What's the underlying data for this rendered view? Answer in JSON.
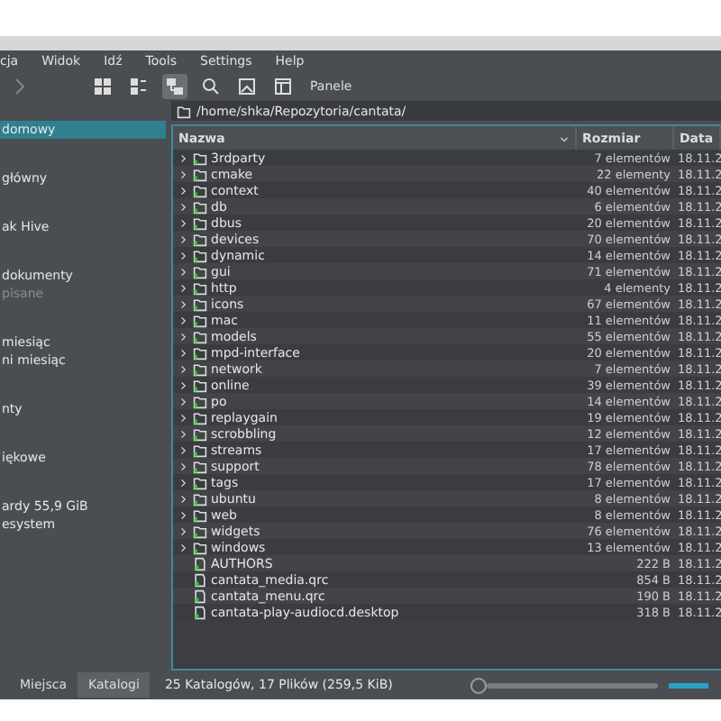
{
  "menu": [
    "cja",
    "Widok",
    "Idź",
    "Tools",
    "Settings",
    "Help"
  ],
  "toolbar": {
    "views": [
      {
        "selected": false
      },
      {
        "selected": false
      },
      {
        "selected": true
      }
    ],
    "panels_label": "Panele"
  },
  "sidebar": {
    "sections": [
      {
        "items": [
          {
            "label": "domowy",
            "selected": true,
            "disabled": false
          }
        ]
      },
      {
        "items": [
          {
            "label": "główny",
            "selected": false,
            "disabled": false
          }
        ]
      },
      {
        "items": [
          {
            "label": "ak Hive",
            "selected": false,
            "disabled": false
          }
        ]
      },
      {
        "items": [
          {
            "label": "dokumenty",
            "selected": false,
            "disabled": false
          },
          {
            "label": "pisane",
            "selected": false,
            "disabled": true
          }
        ]
      },
      {
        "items": [
          {
            "label": "miesiąc",
            "selected": false,
            "disabled": false
          },
          {
            "label": "ni miesiąc",
            "selected": false,
            "disabled": false
          }
        ]
      },
      {
        "items": [
          {
            "label": "nty",
            "selected": false,
            "disabled": false
          }
        ]
      },
      {
        "items": [
          {
            "label": "iękowe",
            "selected": false,
            "disabled": false
          }
        ]
      },
      {
        "items": [
          {
            "label": "ardy 55,9 GiB",
            "selected": false,
            "disabled": false
          },
          {
            "label": "esystem",
            "selected": false,
            "disabled": false
          }
        ]
      }
    ]
  },
  "path": "/home/shka/Repozytoria/cantata/",
  "columns": [
    "Nazwa",
    "Rozmiar",
    "Data"
  ],
  "rows": [
    {
      "kind": "folder",
      "name": "3rdparty",
      "size": "7 elementów",
      "date": "18.11.2"
    },
    {
      "kind": "folder",
      "name": "cmake",
      "size": "22 elementy",
      "date": "18.11.2"
    },
    {
      "kind": "folder",
      "name": "context",
      "size": "40 elementów",
      "date": "18.11.2"
    },
    {
      "kind": "folder",
      "name": "db",
      "size": "6 elementów",
      "date": "18.11.2"
    },
    {
      "kind": "folder",
      "name": "dbus",
      "size": "20 elementów",
      "date": "18.11.2"
    },
    {
      "kind": "folder",
      "name": "devices",
      "size": "70 elementów",
      "date": "18.11.2"
    },
    {
      "kind": "folder",
      "name": "dynamic",
      "size": "14 elementów",
      "date": "18.11.2"
    },
    {
      "kind": "folder",
      "name": "gui",
      "size": "71 elementów",
      "date": "18.11.2"
    },
    {
      "kind": "folder",
      "name": "http",
      "size": "4 elementy",
      "date": "18.11.2"
    },
    {
      "kind": "folder",
      "name": "icons",
      "size": "67 elementów",
      "date": "18.11.2"
    },
    {
      "kind": "folder",
      "name": "mac",
      "size": "11 elementów",
      "date": "18.11.2"
    },
    {
      "kind": "folder",
      "name": "models",
      "size": "55 elementów",
      "date": "18.11.2"
    },
    {
      "kind": "folder",
      "name": "mpd-interface",
      "size": "20 elementów",
      "date": "18.11.2"
    },
    {
      "kind": "folder",
      "name": "network",
      "size": "7 elementów",
      "date": "18.11.2"
    },
    {
      "kind": "folder",
      "name": "online",
      "size": "39 elementów",
      "date": "18.11.2"
    },
    {
      "kind": "folder",
      "name": "po",
      "size": "14 elementów",
      "date": "18.11.2"
    },
    {
      "kind": "folder",
      "name": "replaygain",
      "size": "19 elementów",
      "date": "18.11.2"
    },
    {
      "kind": "folder",
      "name": "scrobbling",
      "size": "12 elementów",
      "date": "18.11.2"
    },
    {
      "kind": "folder",
      "name": "streams",
      "size": "17 elementów",
      "date": "18.11.2"
    },
    {
      "kind": "folder",
      "name": "support",
      "size": "78 elementów",
      "date": "18.11.2"
    },
    {
      "kind": "folder",
      "name": "tags",
      "size": "17 elementów",
      "date": "18.11.2"
    },
    {
      "kind": "folder",
      "name": "ubuntu",
      "size": "8 elementów",
      "date": "18.11.2"
    },
    {
      "kind": "folder",
      "name": "web",
      "size": "8 elementów",
      "date": "18.11.2"
    },
    {
      "kind": "folder",
      "name": "widgets",
      "size": "76 elementów",
      "date": "18.11.2"
    },
    {
      "kind": "folder",
      "name": "windows",
      "size": "13 elementów",
      "date": "18.11.2"
    },
    {
      "kind": "file",
      "name": "AUTHORS",
      "size": "222 B",
      "date": "18.11.2"
    },
    {
      "kind": "file",
      "name": "cantata_media.qrc",
      "size": "854 B",
      "date": "18.11.2"
    },
    {
      "kind": "file",
      "name": "cantata_menu.qrc",
      "size": "190 B",
      "date": "18.11.2"
    },
    {
      "kind": "file",
      "name": "cantata-play-audiocd.desktop",
      "size": "318 B",
      "date": "18.11.2"
    }
  ],
  "tabs": [
    {
      "label": "Miejsca",
      "selected": false
    },
    {
      "label": "Katalogi",
      "selected": true
    }
  ],
  "status": "25 Katalogów, 17 Plików (259,5 KiB)",
  "zoom": {
    "level": 0
  }
}
